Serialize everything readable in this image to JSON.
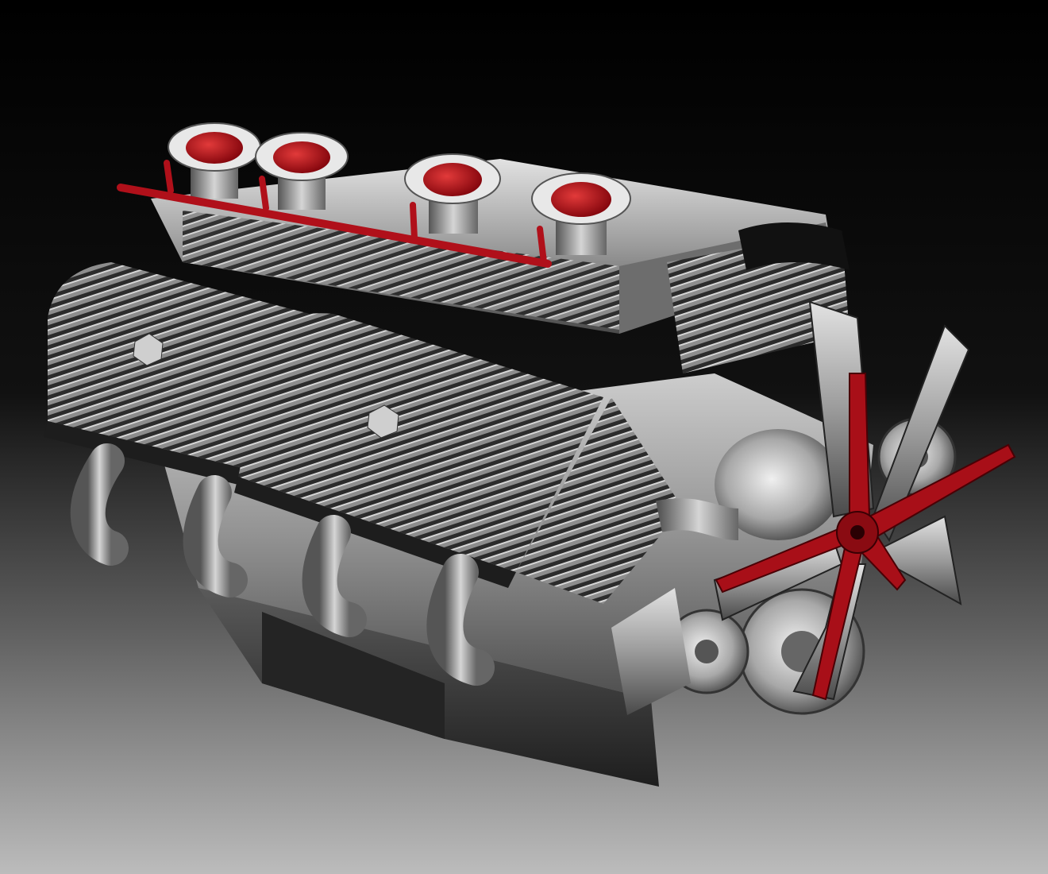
{
  "image": {
    "subject": "engine-render",
    "colors": {
      "background_top": "#000000",
      "background_bottom": "#bcbcbc",
      "metal_light": "#d8d8d8",
      "metal_mid": "#9a9a9a",
      "metal_dark": "#3a3a3a",
      "accent_red": "#b0101a"
    }
  }
}
